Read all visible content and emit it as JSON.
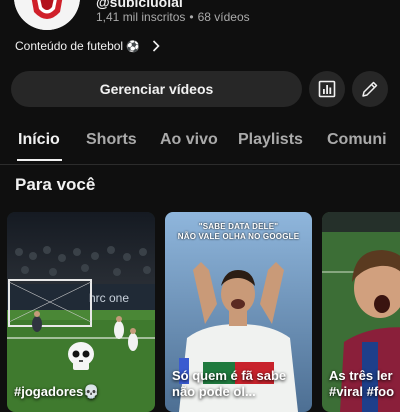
{
  "channel": {
    "handle": "@sublcluolal",
    "subscribers": "1,41 mil inscritos",
    "separator": "•",
    "videos": "68 vídeos",
    "link_text": "Conteúdo de futebol",
    "link_emoji": "⚽"
  },
  "actions": {
    "manage_label": "Gerenciar vídeos"
  },
  "tabs": [
    {
      "label": "Início",
      "active": true
    },
    {
      "label": "Shorts",
      "active": false
    },
    {
      "label": "Ao vivo",
      "active": false
    },
    {
      "label": "Playlists",
      "active": false
    },
    {
      "label": "Comuni",
      "active": false
    }
  ],
  "section": {
    "title": "Para você"
  },
  "shorts": [
    {
      "caption": "#jogadores💀",
      "board_text": "hrc one"
    },
    {
      "overlay_line1": "\"SABE DATA DELE\"",
      "overlay_line2": "NÃO VALE OLHA NO GOOGLE",
      "caption": "Só quem é fã sabe não pode ol..."
    },
    {
      "caption": "As três ler #viral #foo"
    }
  ],
  "icons": [
    "analytics-icon",
    "edit-pencil-icon",
    "chevron-right-icon",
    "skull-icon"
  ],
  "colors": {
    "background": "#0f0f0f",
    "button_bg": "#272727",
    "text_primary": "#f1f1f1",
    "text_secondary": "#aaaaaa",
    "pitch_green": "#3f7a2e"
  }
}
